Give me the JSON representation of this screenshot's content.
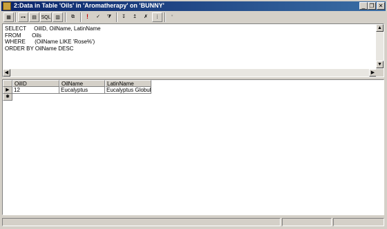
{
  "window": {
    "title": "2:Data in Table 'Oils' in 'Aromatherapy' on 'BUNNY'"
  },
  "caption_buttons": {
    "minimize": "_",
    "restore": "❐",
    "close": "✕"
  },
  "toolbar": {
    "buttons": [
      {
        "name": "properties-button",
        "glyph": "▦"
      },
      {
        "name": "show-diagram-pane-button",
        "glyph": "⊶"
      },
      {
        "name": "show-grid-pane-button",
        "glyph": "▤"
      },
      {
        "name": "show-sql-pane-button",
        "label": "SQL"
      },
      {
        "name": "show-results-pane-button",
        "glyph": "▥"
      },
      {
        "name": "change-query-type-button",
        "glyph": "⧉"
      },
      {
        "name": "run-button",
        "glyph": "!"
      },
      {
        "name": "verify-sql-button",
        "glyph": "✓"
      },
      {
        "name": "remove-filter-button",
        "glyph": "⧩"
      },
      {
        "name": "sort-ascending-button",
        "glyph": "↧"
      },
      {
        "name": "sort-descending-button",
        "glyph": "↥"
      },
      {
        "name": "remove-filter-2-button",
        "glyph": "✗"
      },
      {
        "name": "group-by-button",
        "glyph": "⁞"
      },
      {
        "name": "new-row-button",
        "glyph": "*"
      }
    ]
  },
  "sql": {
    "lines": [
      "SELECT     OilID, OilName, LatinName",
      "FROM       Oils",
      "WHERE      (OilName LIKE 'Rose%')",
      "ORDER BY OilName DESC"
    ]
  },
  "grid": {
    "columns": [
      "OilID",
      "OilName",
      "LatinName"
    ],
    "rows": [
      {
        "marker": "▶",
        "cells": [
          "12",
          "Eucalyptus",
          "Eucalyptus Globulu"
        ]
      },
      {
        "marker": "✱",
        "cells": [
          "",
          "",
          ""
        ]
      }
    ]
  },
  "scroll": {
    "up": "▲",
    "down": "▼",
    "left": "◀",
    "right": "▶"
  }
}
